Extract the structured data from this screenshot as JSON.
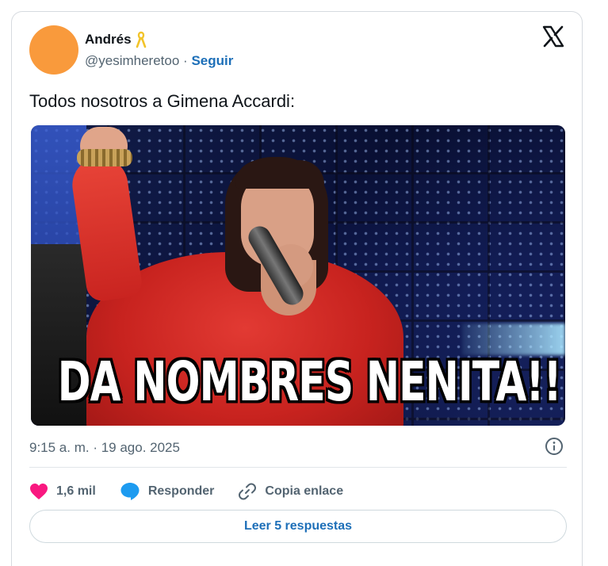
{
  "author": {
    "name": "Andrés",
    "handle": "@yesimheretoo",
    "separator": "·",
    "follow_label": "Seguir",
    "avatar_color": "#f99a3c",
    "badge_icon": "yellow-ribbon-icon"
  },
  "platform_icon": "x-logo-icon",
  "tweet": {
    "text": "Todos nosotros a Gimena Accardi:",
    "media_caption": "DA NOMBRES NENITA!!",
    "timestamp": "9:15 a. m. · 19 ago. 2025"
  },
  "actions": {
    "likes_label": "1,6 mil",
    "reply_label": "Responder",
    "copy_link_label": "Copia enlace"
  },
  "read_replies_label": "Leer 5 respuestas",
  "colors": {
    "link": "#1d6fb8",
    "like": "#f91880",
    "reply": "#1d9bf0",
    "text": "#0f1419",
    "muted": "#536471"
  }
}
